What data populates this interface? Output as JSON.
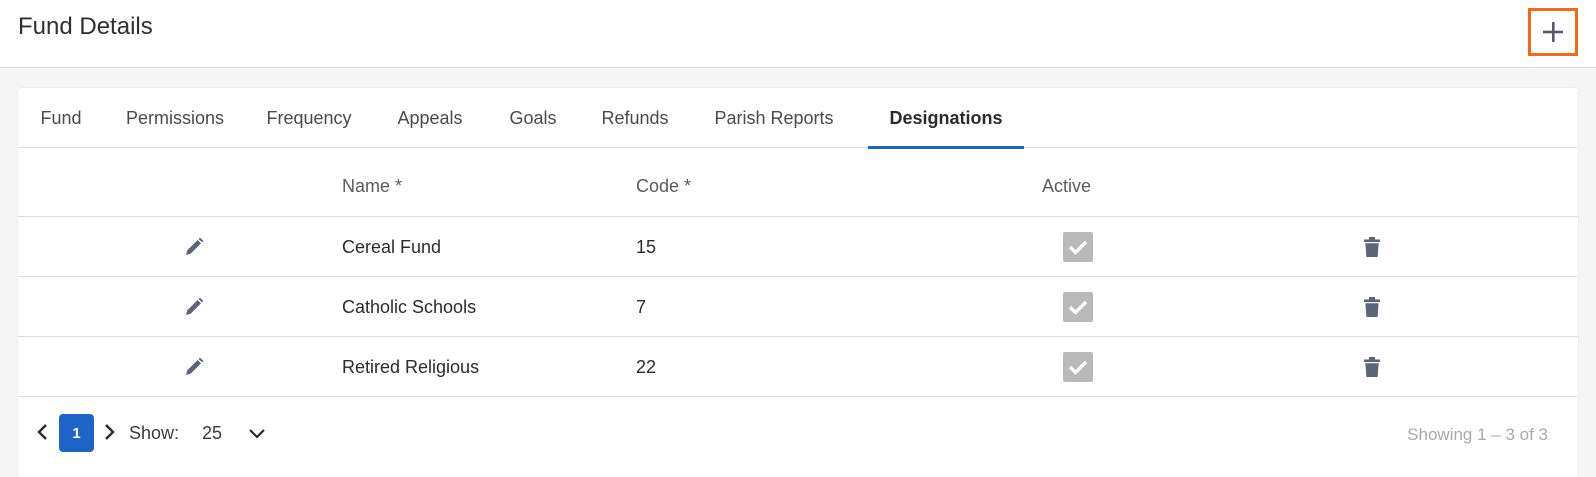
{
  "header": {
    "title": "Fund Details",
    "add_icon": "plus-icon",
    "accent_color": "#f06a18"
  },
  "tabs": [
    {
      "label": "Fund"
    },
    {
      "label": "Permissions"
    },
    {
      "label": "Frequency"
    },
    {
      "label": "Appeals"
    },
    {
      "label": "Goals"
    },
    {
      "label": "Refunds"
    },
    {
      "label": "Parish Reports"
    },
    {
      "label": "Designations",
      "active": true
    }
  ],
  "table": {
    "columns": {
      "name": "Name *",
      "code": "Code *",
      "active": "Active"
    },
    "rows": [
      {
        "name": "Cereal Fund",
        "code": "15",
        "active": true
      },
      {
        "name": "Catholic Schools",
        "code": "7",
        "active": true
      },
      {
        "name": "Retired Religious",
        "code": "22",
        "active": true
      }
    ],
    "icons": {
      "edit": "pencil-icon",
      "delete": "trash-icon",
      "active": "checkmark-icon"
    }
  },
  "pagination": {
    "current_page": "1",
    "show_label": "Show:",
    "page_size": "25",
    "summary": "Showing 1 – 3 of 3",
    "active_color": "#1e64c8"
  }
}
